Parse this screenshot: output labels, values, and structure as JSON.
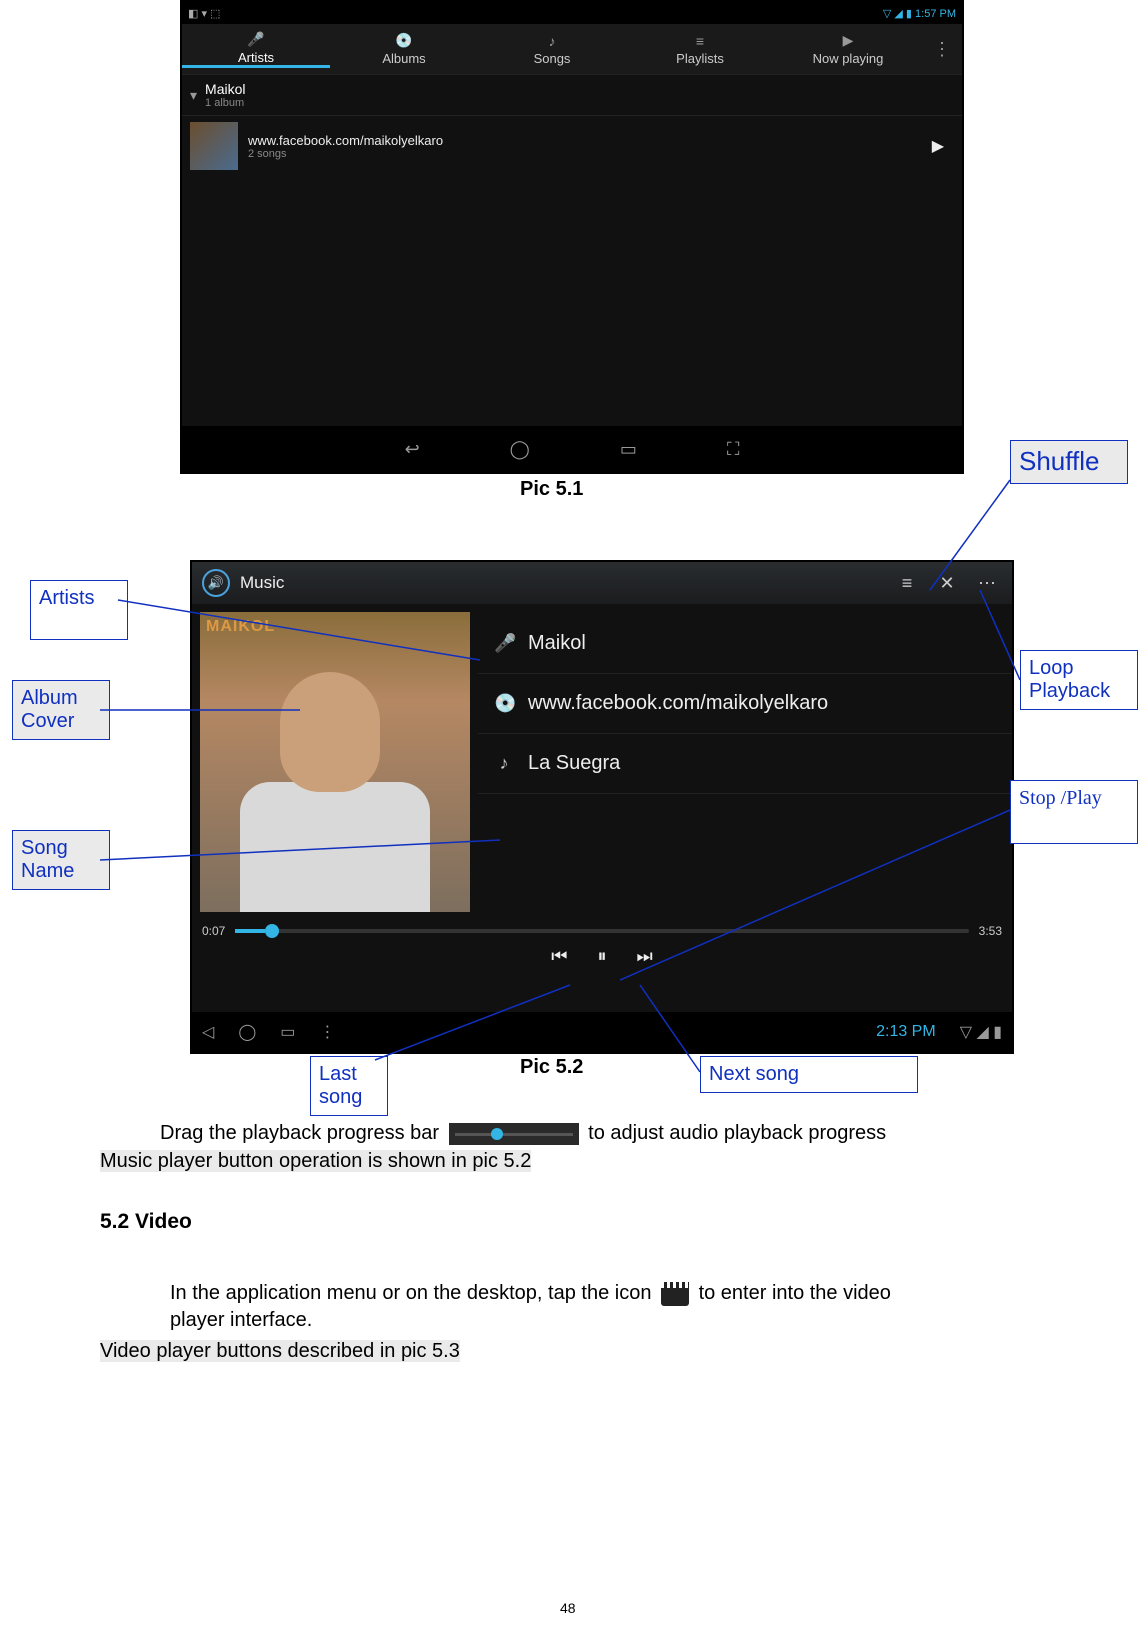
{
  "shot1": {
    "status_left": "◧ ▾ ⬚",
    "status_right": "▽ ◢ ▮ 1:57 PM",
    "tabs": [
      "Artists",
      "Albums",
      "Songs",
      "Playlists",
      "Now playing"
    ],
    "tab_icons": [
      "🎤",
      "💿",
      "♪",
      "≡",
      "▶"
    ],
    "artist_name": "Maikol",
    "artist_sub": "1 album",
    "album_line1": "www.facebook.com/maikolyelkaro",
    "album_line2": "2 songs",
    "nav_icons": [
      "↩",
      "◯",
      "▭",
      "⛶"
    ]
  },
  "caption1": "Pic 5.1",
  "shot2": {
    "title": "Music",
    "top_icons": [
      "≡",
      "✕",
      "⋯"
    ],
    "cover_brand": "MAIKOL",
    "tracks": [
      {
        "icon": "🎤",
        "label": "Maikol"
      },
      {
        "icon": "💿",
        "label": "www.facebook.com/maikolyelkaro"
      },
      {
        "icon": "♪",
        "label": "La Suegra"
      }
    ],
    "time_left": "0:07",
    "time_right": "3:53",
    "controls": [
      "⏮",
      "⏸",
      "⏭"
    ],
    "sysbar_left": [
      "◁",
      "◯",
      "▭",
      "⋮"
    ],
    "sysbar_clock": "2:13 PM",
    "sysbar_right": "▽ ◢ ▮"
  },
  "caption2": "Pic 5.2",
  "callouts": {
    "shuffle": "Shuffle",
    "artists": "Artists",
    "album_cover": "Album Cover",
    "song_name": "Song Name",
    "loop_playback": "Loop Playback",
    "stop_play": "Stop /Play",
    "last_song": "Last song",
    "next_song": "Next song"
  },
  "text": {
    "drag_line_a": "Drag the playback progress bar",
    "drag_line_b": "to adjust audio playback progress",
    "music_ops": "Music player button operation is shown in pic 5.2",
    "heading_video": "5.2 Video",
    "video_line_a": "In the application menu or on the desktop, tap the icon",
    "video_line_b": "to enter into the video",
    "video_line_c": "player interface.",
    "video_ops": "Video player buttons described in pic 5.3",
    "pagenum": "48"
  }
}
